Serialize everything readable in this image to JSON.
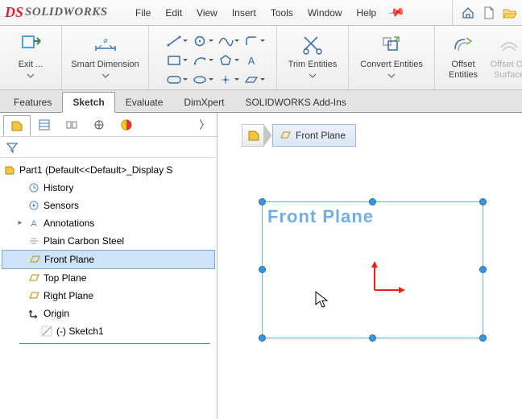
{
  "brand": {
    "ds": "DS",
    "name": "SOLIDWORKS"
  },
  "menus": [
    "File",
    "Edit",
    "View",
    "Insert",
    "Tools",
    "Window",
    "Help"
  ],
  "ribbon": {
    "exit": "Exit ...",
    "smart_dim": "Smart Dimension",
    "trim": "Trim Entities",
    "convert": "Convert Entities",
    "offset": "Offset\nEntities",
    "offset_on": "Offset On\nSurface"
  },
  "tabs": [
    {
      "label": "Features",
      "active": false
    },
    {
      "label": "Sketch",
      "active": true
    },
    {
      "label": "Evaluate",
      "active": false
    },
    {
      "label": "DimXpert",
      "active": false
    },
    {
      "label": "SOLIDWORKS Add-Ins",
      "active": false
    }
  ],
  "tree": {
    "root": "Part1  (Default<<Default>_Display S",
    "items": [
      {
        "label": "History",
        "icon": "history"
      },
      {
        "label": "Sensors",
        "icon": "sensors"
      },
      {
        "label": "Annotations",
        "icon": "annotations",
        "expander": "▸"
      },
      {
        "label": "Plain Carbon Steel",
        "icon": "material"
      },
      {
        "label": "Front Plane",
        "icon": "plane",
        "selected": true
      },
      {
        "label": "Top Plane",
        "icon": "plane"
      },
      {
        "label": "Right Plane",
        "icon": "plane"
      },
      {
        "label": "Origin",
        "icon": "origin"
      },
      {
        "label": "(-) Sketch1",
        "icon": "sketch"
      }
    ]
  },
  "breadcrumb": {
    "label": "Front Plane"
  },
  "gfx_plane_label": "Front Plane"
}
